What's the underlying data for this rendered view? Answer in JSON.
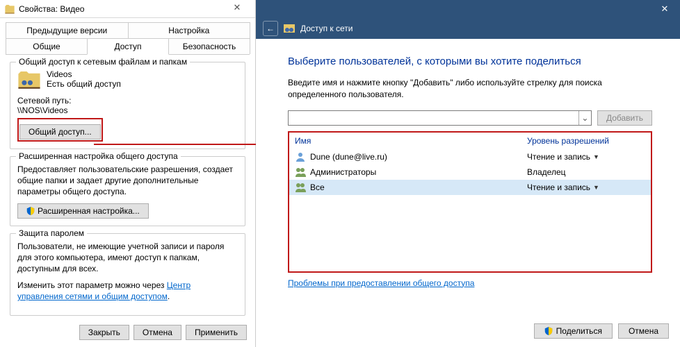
{
  "left": {
    "title": "Свойства: Видео",
    "tabs_row1": [
      "Предыдущие версии",
      "Настройка"
    ],
    "tabs_row2": [
      "Общие",
      "Доступ",
      "Безопасность"
    ],
    "group1": {
      "legend": "Общий доступ к сетевым файлам и папкам",
      "folder_name": "Videos",
      "folder_state": "Есть общий доступ",
      "netpath_label": "Сетевой путь:",
      "netpath_value": "\\\\NOS\\Videos",
      "share_btn": "Общий доступ..."
    },
    "group2": {
      "legend": "Расширенная настройка общего доступа",
      "hint": "Предоставляет пользовательские разрешения, создает общие папки и задает другие дополнительные параметры общего доступа.",
      "adv_btn": "Расширенная настройка..."
    },
    "group3": {
      "legend": "Защита паролем",
      "hint": "Пользователи, не имеющие учетной записи и пароля для этого компьютера, имеют доступ к папкам, доступным для всех.",
      "change_prefix": "Изменить этот параметр можно через ",
      "change_link": "Центр управления сетями и общим доступом"
    },
    "buttons": {
      "close": "Закрыть",
      "cancel": "Отмена",
      "apply": "Применить"
    }
  },
  "right": {
    "nav_title": "Доступ к сети",
    "heading": "Выберите пользователей, с которыми вы хотите поделиться",
    "instruction": "Введите имя и нажмите кнопку \"Добавить\" либо используйте стрелку для поиска определенного пользователя.",
    "add_btn": "Добавить",
    "col_name": "Имя",
    "col_perm": "Уровень разрешений",
    "rows": [
      {
        "name": "Dune  (dune@live.ru)",
        "perm": "Чтение и запись",
        "dd": true
      },
      {
        "name": "Администраторы",
        "perm": "Владелец",
        "dd": false
      },
      {
        "name": "Все",
        "perm": "Чтение и запись",
        "dd": true
      }
    ],
    "problems_link": "Проблемы при предоставлении общего доступа",
    "share_btn": "Поделиться",
    "cancel_btn": "Отмена"
  }
}
